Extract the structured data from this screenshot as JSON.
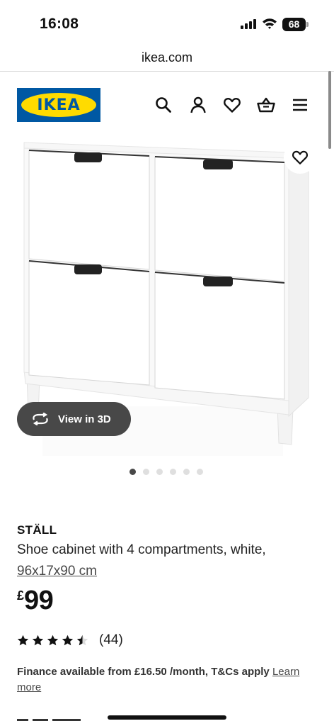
{
  "status_bar": {
    "time": "16:08",
    "battery": "68",
    "icons": [
      "signal-icon",
      "wifi-icon",
      "battery-icon"
    ]
  },
  "browser": {
    "url": "ikea.com"
  },
  "header": {
    "logo_text": "IKEA",
    "icons": [
      "search-icon",
      "account-icon",
      "favourites-icon",
      "basket-icon",
      "menu-icon"
    ]
  },
  "gallery": {
    "view_3d_label": "View in 3D",
    "slide_count": 6,
    "active_slide": 1
  },
  "product": {
    "name": "STÄLL",
    "description": "Shoe cabinet with 4 compartments, white,",
    "size": "96x17x90 cm",
    "price_currency": "£",
    "price_value": "99",
    "rating": 4.5,
    "rating_max": 5,
    "review_count": "(44)"
  },
  "finance": {
    "text": "Finance available from £16.50 /month, T&Cs apply",
    "link": "Learn more"
  },
  "colors": {
    "ikea_blue": "#0058a3",
    "ikea_yellow": "#ffdb00",
    "pill_bg": "#484848",
    "text": "#111111"
  }
}
